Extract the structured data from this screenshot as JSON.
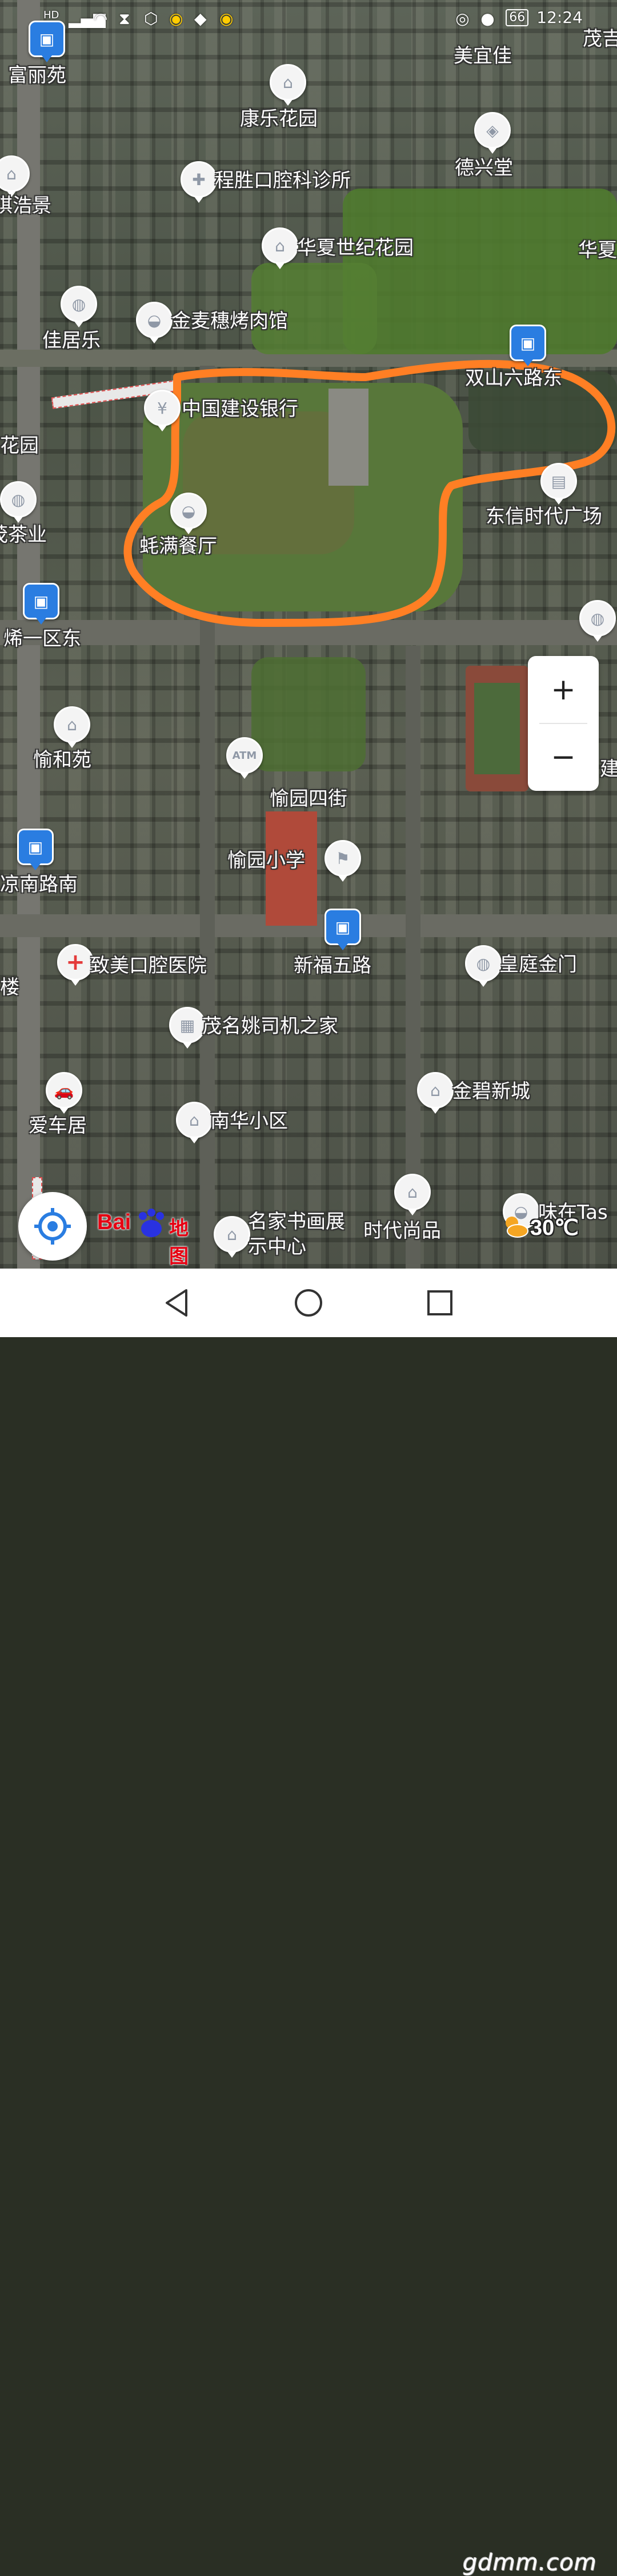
{
  "status_bar": {
    "battery": "66",
    "time": "12:24"
  },
  "map": {
    "pois": [
      {
        "name": "富丽苑",
        "icon": "bus-stop-icon"
      },
      {
        "name": "美宜佳",
        "icon": "shop-icon"
      },
      {
        "name": "茂吉",
        "icon": "none"
      },
      {
        "name": "康乐花园",
        "icon": "residential-icon"
      },
      {
        "name": "德兴堂",
        "icon": "pharmacy-icon"
      },
      {
        "name": "琪浩景",
        "icon": "residential-icon"
      },
      {
        "name": "程胜口腔科诊所",
        "icon": "clinic-icon"
      },
      {
        "name": "华夏世纪花园",
        "icon": "residential-icon"
      },
      {
        "name": "华夏",
        "icon": "none"
      },
      {
        "name": "佳居乐",
        "icon": "shop-icon"
      },
      {
        "name": "金麦穗烤肉馆",
        "icon": "restaurant-icon"
      },
      {
        "name": "双山六路东",
        "icon": "bus-stop-icon"
      },
      {
        "name": "中国建设银行",
        "icon": "bank-icon"
      },
      {
        "name": "花园",
        "icon": "none"
      },
      {
        "name": "东信时代广场",
        "icon": "mall-icon"
      },
      {
        "name": "茂茶业",
        "icon": "shop-icon"
      },
      {
        "name": "蚝满餐厅",
        "icon": "restaurant-icon"
      },
      {
        "name": "烯一区东",
        "icon": "bus-stop-icon"
      },
      {
        "name": "愉和苑",
        "icon": "residential-icon"
      },
      {
        "name": "愉园四街",
        "icon": "atm-icon"
      },
      {
        "name": "建",
        "icon": "none"
      },
      {
        "name": "愉园小学",
        "icon": "school-icon"
      },
      {
        "name": "凉南路南",
        "icon": "bus-stop-icon"
      },
      {
        "name": "致美口腔医院",
        "icon": "hospital-icon"
      },
      {
        "name": "新福五路",
        "icon": "bus-stop-icon"
      },
      {
        "name": "皇庭金门",
        "icon": "shop-icon"
      },
      {
        "name": "楼",
        "icon": "none"
      },
      {
        "name": "茂名姚司机之家",
        "icon": "office-icon"
      },
      {
        "name": "金碧新城",
        "icon": "residential-icon"
      },
      {
        "name": "爱车居",
        "icon": "car-icon"
      },
      {
        "name": "南华小区",
        "icon": "residential-icon"
      },
      {
        "name": "名家书画展示中心",
        "icon": "museum-icon"
      },
      {
        "name": "时代尚品",
        "icon": "residential-icon"
      },
      {
        "name": "味在Tas",
        "icon": "restaurant-icon"
      }
    ],
    "annotation_color": "#ff7f24"
  },
  "zoom": {
    "in_label": "+",
    "out_label": "−"
  },
  "branding": {
    "bai": "Bai",
    "ditu": "地图"
  },
  "weather": {
    "temperature": "30℃",
    "icon": "sun-cloud-icon"
  },
  "watermark": "gdmm.com"
}
